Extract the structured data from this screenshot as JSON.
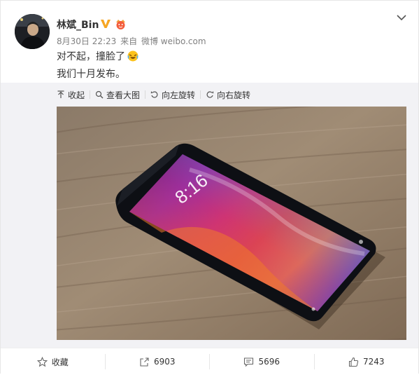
{
  "post": {
    "author": "林斌_Bin",
    "time": "8月30日 22:23",
    "source_prefix": "来自",
    "source": "微博 weibo.com",
    "line1": "对不起，撞脸了",
    "line2": "我们十月发布。"
  },
  "toolbar": {
    "collapse": "收起",
    "view_large": "查看大图",
    "rotate_left": "向左旋转",
    "rotate_right": "向右旋转"
  },
  "actions": {
    "favorite": "收藏",
    "repost": "6903",
    "comment": "5696",
    "like": "7243"
  },
  "phone_screen": {
    "clock": "8:16"
  },
  "colors": {
    "accent": "#eb7350",
    "verified": "#f6a623",
    "media_bg": "#f2f2f5"
  }
}
